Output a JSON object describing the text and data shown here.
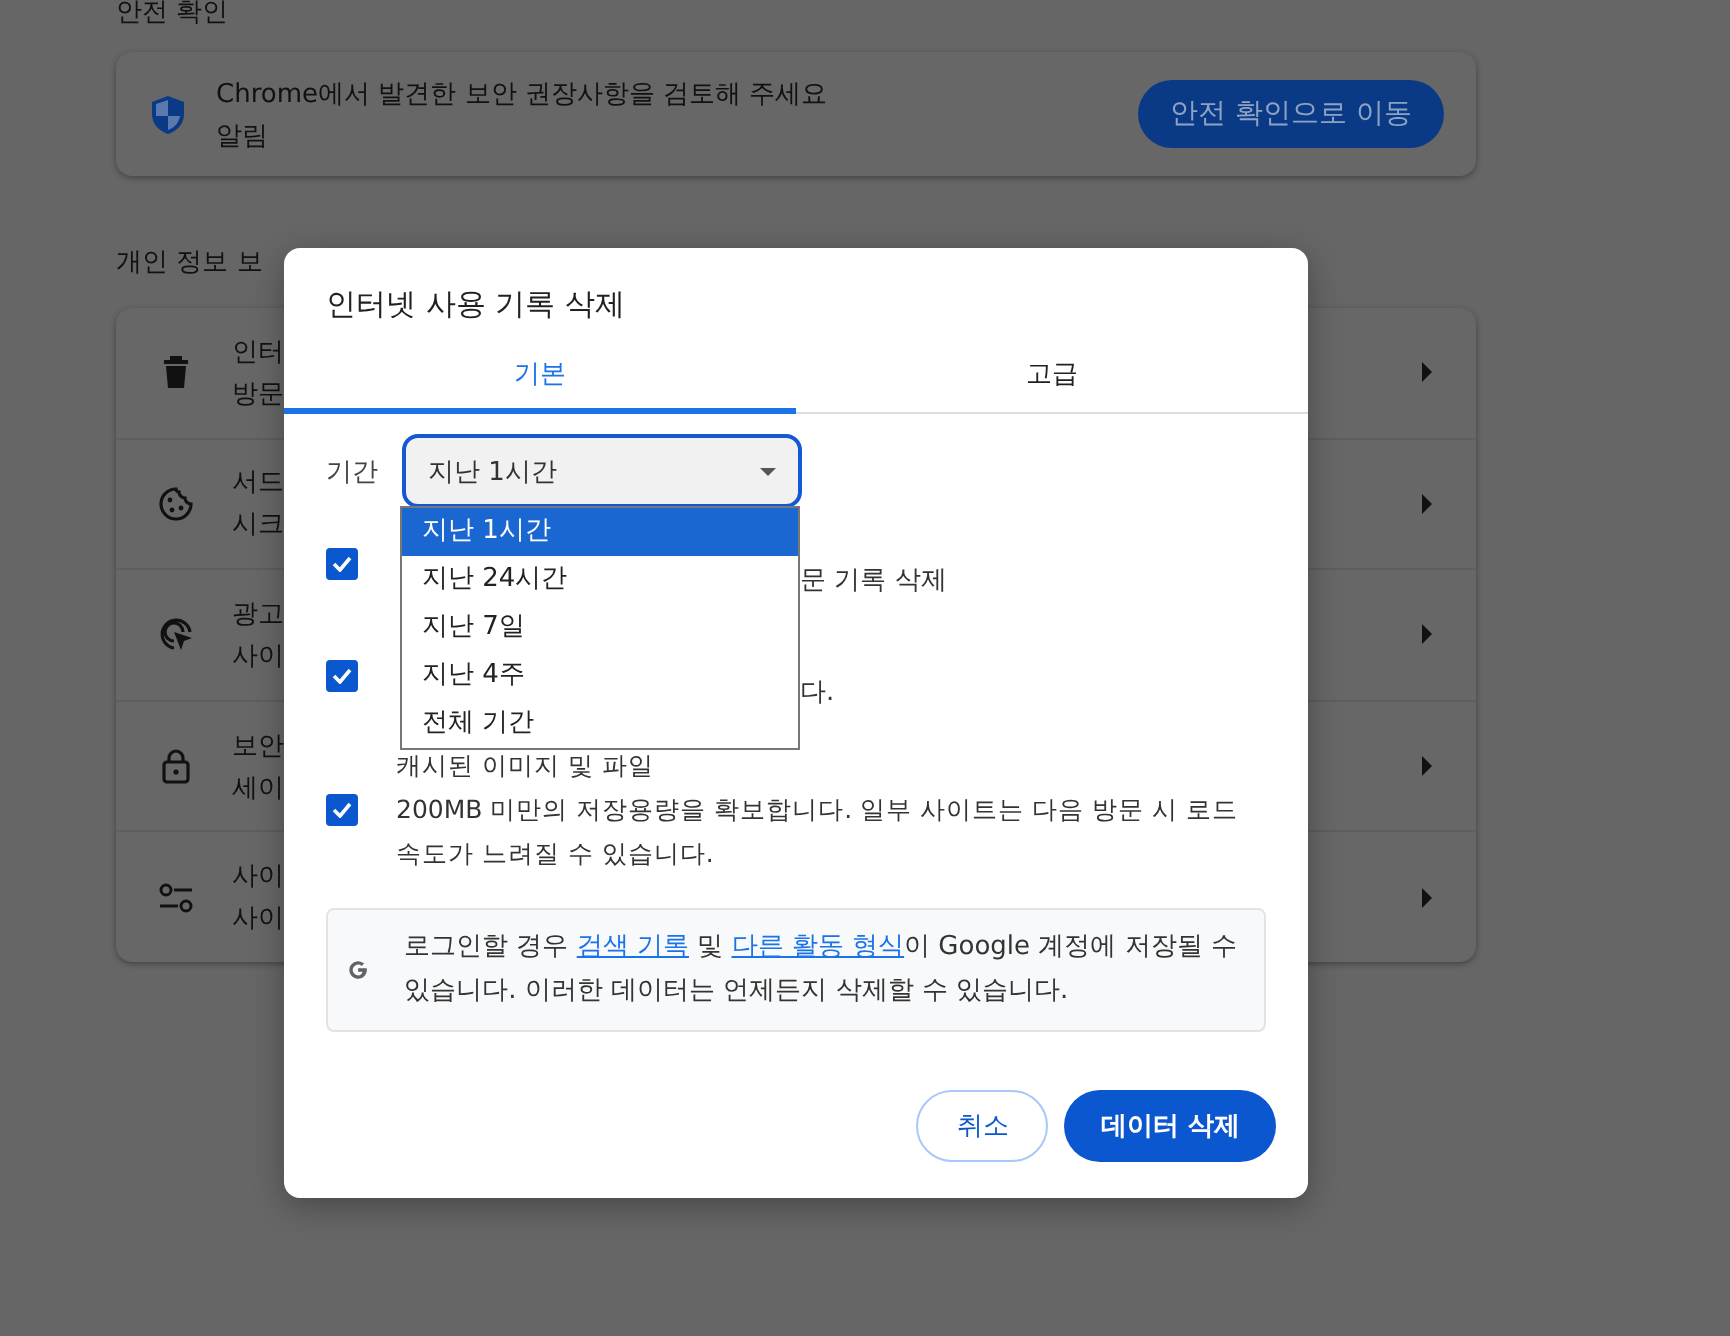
{
  "background": {
    "section_title": "안전 확인",
    "safety_card": {
      "title": "Chrome에서 발견한 보안 권장사항을 검토해 주세요",
      "subtitle": "알림",
      "button": "안전 확인으로 이동"
    },
    "privacy_title": "개인 정보 보",
    "privacy_rows": [
      {
        "title": "인터",
        "subtitle": "방문"
      },
      {
        "title": "서드",
        "subtitle": "시크"
      },
      {
        "title": "광고",
        "subtitle": "사이"
      },
      {
        "title": "보안",
        "subtitle": "세이"
      },
      {
        "title": "사이",
        "subtitle": "사이"
      }
    ]
  },
  "dialog": {
    "title": "인터넷 사용 기록 삭제",
    "tabs": [
      {
        "label": "기본",
        "selected": true
      },
      {
        "label": "고급",
        "selected": false
      }
    ],
    "period": {
      "label": "기간",
      "value": "지난 1시간",
      "options": [
        {
          "label": "지난 1시간",
          "selected": true
        },
        {
          "label": "지난 24시간",
          "selected": false
        },
        {
          "label": "지난 7일",
          "selected": false
        },
        {
          "label": "지난 4주",
          "selected": false
        },
        {
          "label": "전체 기간",
          "selected": false
        }
      ]
    },
    "checkboxes": [
      {
        "kind": "covered",
        "checked": true,
        "description": "문 기록 삭제"
      },
      {
        "kind": "covered",
        "checked": true,
        "description": "다."
      },
      {
        "kind": "full",
        "checked": true,
        "title": "캐시된 이미지 및 파일",
        "description": "200MB 미만의 저장용량을 확보합니다. 일부 사이트는 다음 방문 시 로드 속도가 느려질 수 있습니다."
      }
    ],
    "info": [
      {
        "text": "로그인할 경우 ",
        "link": false
      },
      {
        "text": "검색 기록",
        "link": true
      },
      {
        "text": " 및 ",
        "link": false
      },
      {
        "text": "다른 활동 형식",
        "link": true
      },
      {
        "text": "이 Google 계정에 저장될 수 있습니다. 이러한 데이터는 언제든지 삭제할 수 있습니다.",
        "link": false
      }
    ],
    "buttons": [
      {
        "kind": "secondary",
        "label": "취소"
      },
      {
        "kind": "primary",
        "label": "데이터 삭제"
      }
    ]
  }
}
